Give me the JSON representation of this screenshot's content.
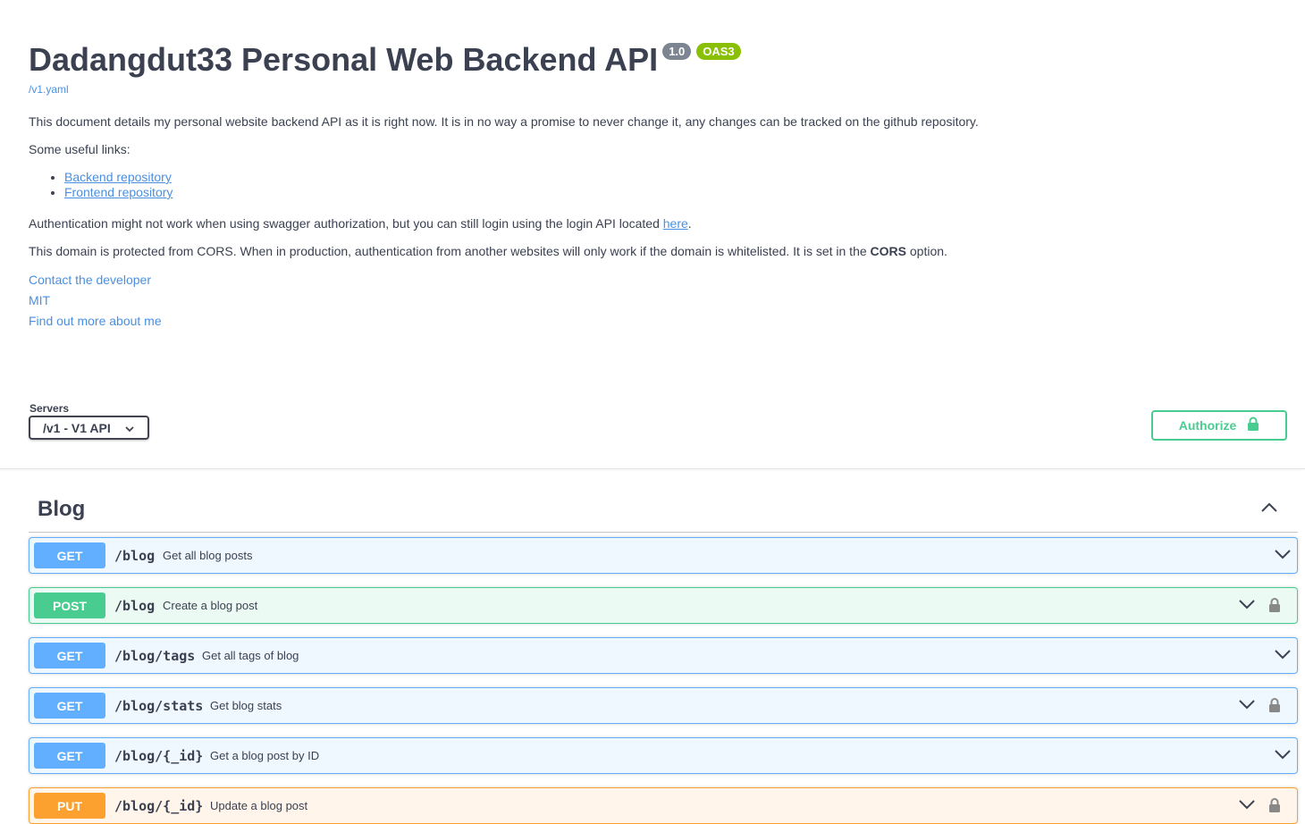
{
  "info": {
    "title": "Dadangdut33 Personal Web Backend API",
    "version": "1.0",
    "oas": "OAS3",
    "spec_link": "/v1.yaml",
    "description": "This document details my personal website backend API as it is right now. It is in no way a promise to never change it, any changes can be tracked on the github repository.",
    "useful_links_label": "Some useful links:",
    "links": [
      "Backend repository",
      "Frontend repository"
    ],
    "auth_note_prefix": "Authentication might not work when using swagger authorization, but you can still login using the login API located ",
    "auth_note_link": "here",
    "auth_note_suffix": ".",
    "cors_prefix": "This domain is protected from CORS. When in production, authentication from another websites will only work if the domain is whitelisted. It is set in the ",
    "cors_bold": "CORS",
    "cors_suffix": " option.",
    "contact": "Contact the developer",
    "license": "MIT",
    "external_docs": "Find out more about me"
  },
  "servers": {
    "label": "Servers",
    "selected": "/v1 - V1 API"
  },
  "authorize": {
    "label": "Authorize"
  },
  "tag": {
    "name": "Blog"
  },
  "operations": [
    {
      "method": "GET",
      "path": "/blog",
      "summary": "Get all blog posts",
      "locked": false
    },
    {
      "method": "POST",
      "path": "/blog",
      "summary": "Create a blog post",
      "locked": true
    },
    {
      "method": "GET",
      "path": "/blog/tags",
      "summary": "Get all tags of blog",
      "locked": false
    },
    {
      "method": "GET",
      "path": "/blog/stats",
      "summary": "Get blog stats",
      "locked": true
    },
    {
      "method": "GET",
      "path": "/blog/{_id}",
      "summary": "Get a blog post by ID",
      "locked": false
    },
    {
      "method": "PUT",
      "path": "/blog/{_id}",
      "summary": "Update a blog post",
      "locked": true
    }
  ],
  "colors": {
    "get": "#61affe",
    "post": "#49cc90",
    "put": "#fca130",
    "link": "#4990e2",
    "text": "#3b4151"
  }
}
